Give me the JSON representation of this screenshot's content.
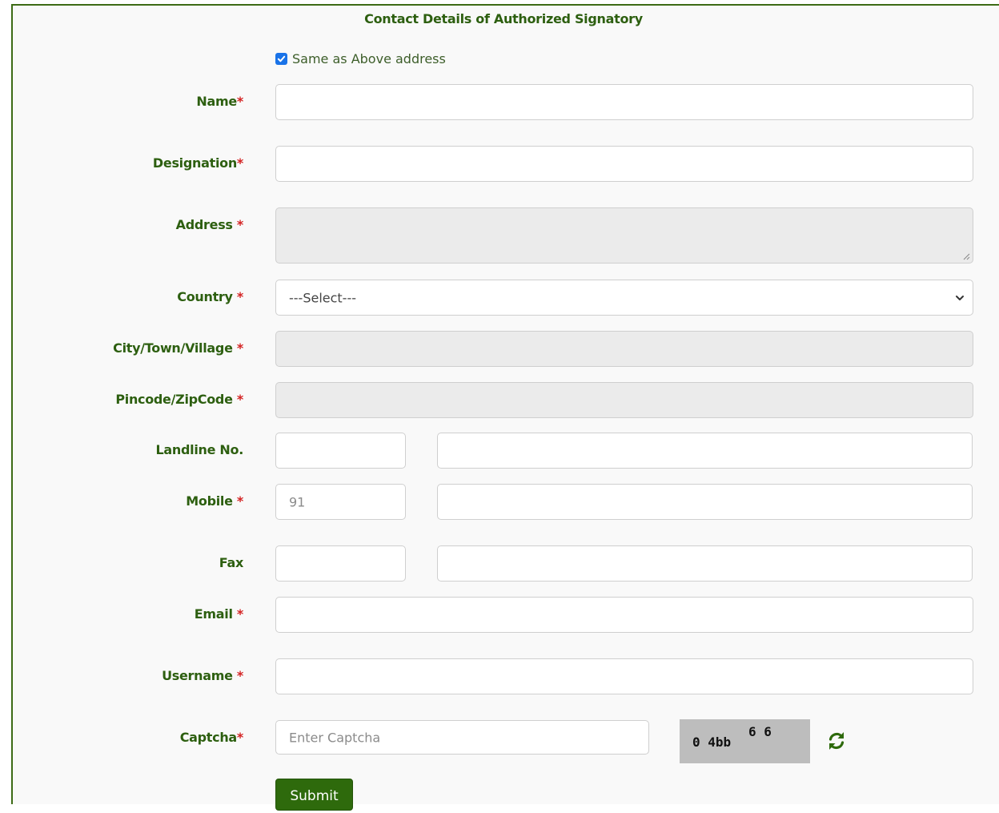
{
  "form": {
    "title": "Contact Details of Authorized Signatory",
    "same_address_label": "Same as Above address",
    "same_address_checked": true,
    "required_mark": "*",
    "submit_label": "Submit"
  },
  "fields": {
    "name": {
      "label": "Name",
      "value": ""
    },
    "designation": {
      "label": "Designation",
      "value": ""
    },
    "address": {
      "label": "Address",
      "value": ""
    },
    "country": {
      "label": "Country",
      "selected": "---Select---"
    },
    "city": {
      "label": "City/Town/Village",
      "value": ""
    },
    "pincode": {
      "label": "Pincode/ZipCode",
      "value": ""
    },
    "landline": {
      "label": "Landline No.",
      "code": "",
      "number": ""
    },
    "mobile": {
      "label": "Mobile",
      "code_placeholder": "91",
      "number": ""
    },
    "fax": {
      "label": "Fax",
      "code": "",
      "number": ""
    },
    "email": {
      "label": "Email",
      "value": ""
    },
    "username": {
      "label": "Username",
      "value": ""
    },
    "captcha": {
      "label": "Captcha",
      "placeholder": "Enter Captcha",
      "image_text_main": "0 4bb",
      "image_text_raised": "6 6"
    }
  },
  "colors": {
    "label_green": "#2d5f10",
    "required_red": "#d42222",
    "submit_bg": "#2e6a0c",
    "checkbox_blue": "#1a73e8"
  },
  "icons": {
    "refresh": "refresh-icon",
    "checkbox": "checkmark-icon",
    "dropdown": "chevron-down-icon"
  }
}
